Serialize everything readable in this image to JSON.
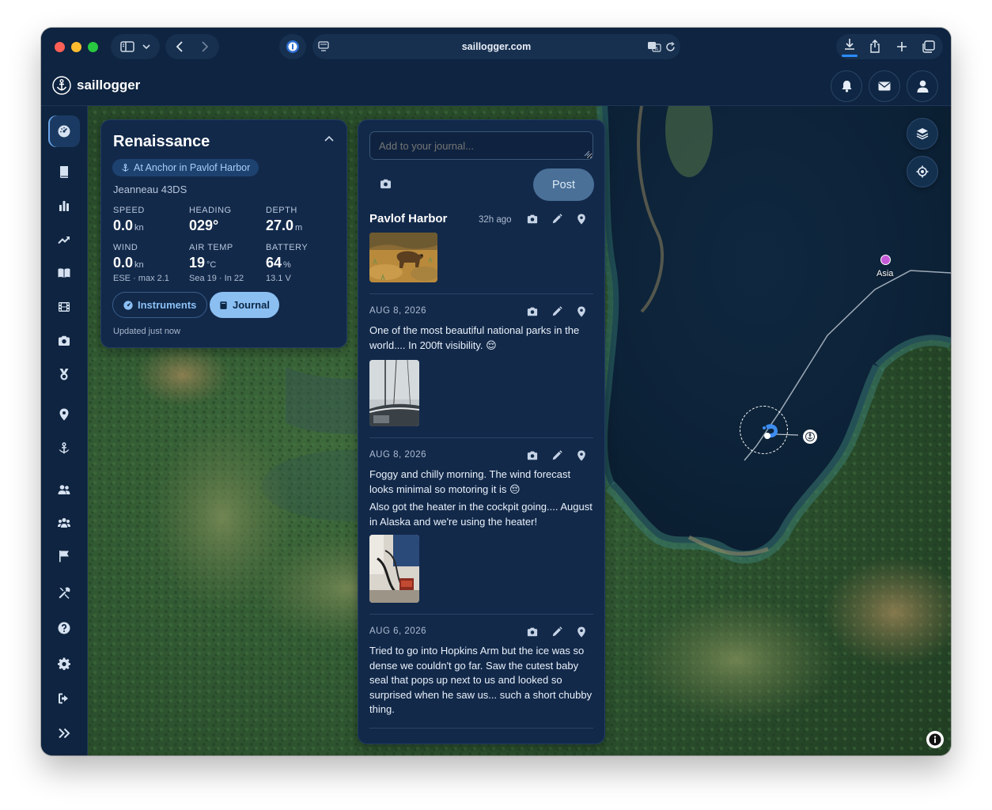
{
  "browser": {
    "url": "saillogger.com"
  },
  "app": {
    "brand": "saillogger"
  },
  "sidebar": {
    "items": [
      {
        "name": "dashboard",
        "icon": "gauge-icon",
        "active": true
      },
      {
        "name": "logbook",
        "icon": "book-icon"
      },
      {
        "name": "stats",
        "icon": "bar-chart-icon"
      },
      {
        "name": "trends",
        "icon": "trend-icon"
      },
      {
        "name": "journal",
        "icon": "open-book-icon"
      },
      {
        "name": "videos",
        "icon": "film-icon"
      },
      {
        "name": "photos",
        "icon": "camera-icon"
      },
      {
        "name": "awards",
        "icon": "medal-icon"
      },
      {
        "name": "places",
        "icon": "map-pin-icon"
      },
      {
        "name": "anchorages",
        "icon": "anchor-icon"
      },
      {
        "name": "crew",
        "icon": "users-icon"
      },
      {
        "name": "community",
        "icon": "group-icon"
      },
      {
        "name": "flags",
        "icon": "flag-icon"
      },
      {
        "name": "tools",
        "icon": "tools-icon"
      },
      {
        "name": "help",
        "icon": "help-icon"
      },
      {
        "name": "settings",
        "icon": "gear-icon"
      },
      {
        "name": "logout",
        "icon": "logout-icon"
      },
      {
        "name": "expand",
        "icon": "double-chevron-icon"
      }
    ]
  },
  "boat": {
    "name": "Renaissance",
    "status": "At Anchor in Pavlof Harbor",
    "model": "Jeanneau 43DS",
    "stats": {
      "speed": {
        "label": "SPEED",
        "value": "0.0",
        "unit": "kn"
      },
      "heading": {
        "label": "HEADING",
        "value": "029°",
        "unit": ""
      },
      "depth": {
        "label": "DEPTH",
        "value": "27.0",
        "unit": "m"
      },
      "wind": {
        "label": "WIND",
        "value": "0.0",
        "unit": "kn",
        "sub": "ESE · max 2.1"
      },
      "air_temp": {
        "label": "AIR TEMP",
        "value": "19",
        "unit": "°C",
        "sub": "Sea 19 · In 22"
      },
      "battery": {
        "label": "BATTERY",
        "value": "64",
        "unit": "%",
        "sub": "13.1 V"
      }
    },
    "instruments_label": "Instruments",
    "journal_label": "Journal",
    "updated": "Updated just now"
  },
  "journal": {
    "placeholder": "Add to your journal...",
    "post_label": "Post",
    "entries": [
      {
        "title": "Pavlof Harbor",
        "ago": "32h ago"
      },
      {
        "date": "AUG 8, 2026",
        "text": "One of the most beautiful national parks in the world.... In 200ft visibility. 😌"
      },
      {
        "date": "AUG 8, 2026",
        "text": "Foggy and chilly morning. The wind forecast looks minimal so motoring it is 😔",
        "text2": "Also got the heater in the cockpit going.... August in Alaska and we're using the heater!"
      },
      {
        "date": "AUG 6, 2026",
        "text": "Tried to go into Hopkins Arm but the ice was so dense we couldn't go far. Saw the cutest baby seal that pops up next to us and looked so surprised when he saw us... such a short chubby thing."
      }
    ]
  },
  "map": {
    "waypoint_label": "Asia",
    "waypoint_color": "#c55ad8",
    "track_color": "#b8c3cf"
  }
}
